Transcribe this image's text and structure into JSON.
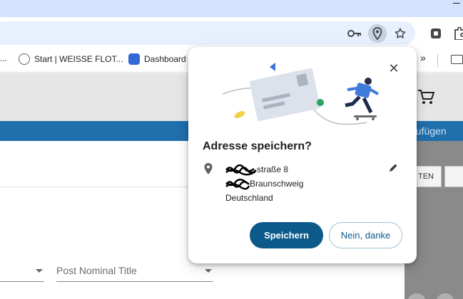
{
  "browser": {
    "bookmarks": [
      {
        "label": "Start | WEISSE FLOT...",
        "icon": "globe-bookmark-icon"
      },
      {
        "label": "Dashboard",
        "icon": "dashboard-bookmark-icon"
      }
    ],
    "bookmarks_overflow": "»",
    "dots": "..."
  },
  "page": {
    "bluebar_text": "nzufügen",
    "dropdown_label": "Post Nominal Title",
    "side_button_text": "TEN"
  },
  "popup": {
    "title": "Adresse speichern?",
    "address": {
      "line1_visible": "straße 8",
      "line2_visible": "Braunschweig",
      "line3": "Deutschland"
    },
    "save_label": "Speichern",
    "decline_label": "Nein, danke"
  },
  "colors": {
    "primary": "#0b5a8a",
    "bluebar": "#1f6fad",
    "tabstrip": "#d3e3fd"
  }
}
